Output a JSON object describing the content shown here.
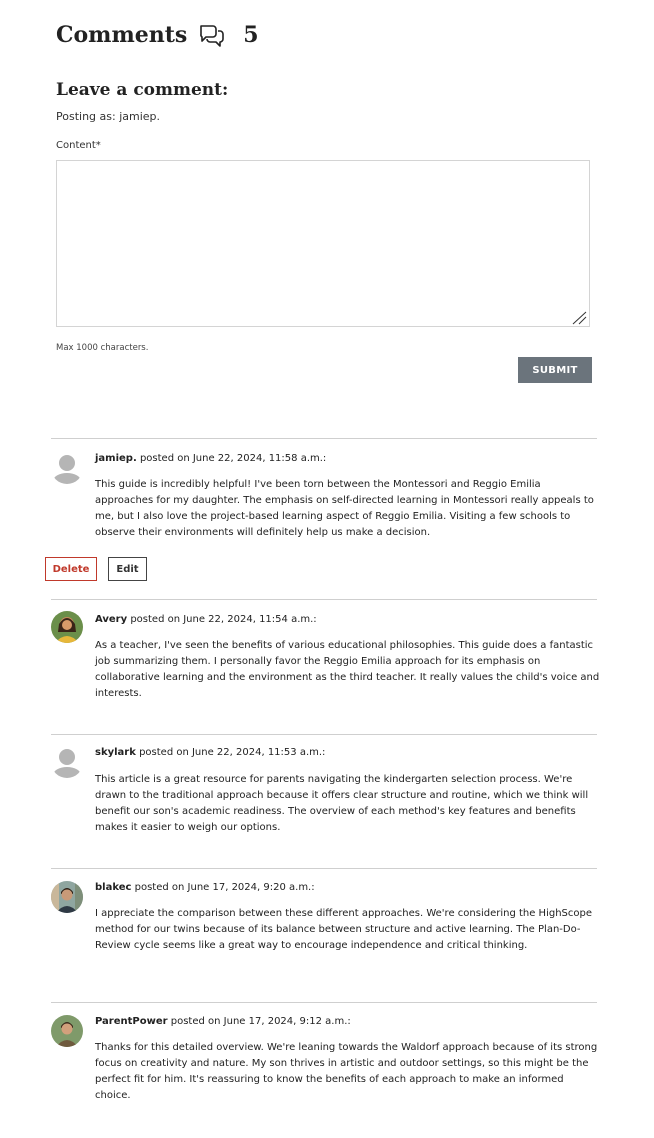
{
  "header": {
    "title": "Comments",
    "icon": "comments-icon",
    "count": "5"
  },
  "form": {
    "title": "Leave a comment:",
    "posting_as": "Posting as: jamiep.",
    "content_label": "Content*",
    "content_value": "",
    "max_chars": "Max 1000 characters.",
    "submit_label": "SUBMIT"
  },
  "comments": [
    {
      "author": "jamiep.",
      "posted": " posted on June 22, 2024, 11:58 a.m.:",
      "text": "This guide is incredibly helpful! I've been torn between the Montessori and Reggio Emilia approaches for my daughter. The emphasis on self-directed learning in Montessori really appeals to me, but I also love the project-based learning aspect of Reggio Emilia. Visiting a few schools to observe their environments will definitely help us make a decision.",
      "avatar": "default-avatar-icon"
    },
    {
      "author": "Avery",
      "posted": " posted on June 22, 2024, 11:54 a.m.:",
      "text": "As a teacher, I've seen the benefits of various educational philosophies. This guide does a fantastic job summarizing them. I personally favor the Reggio Emilia approach for its emphasis on collaborative learning and the environment as the third teacher. It really values the child's voice and interests.",
      "avatar": "user-photo-avatar"
    },
    {
      "author": "skylark",
      "posted": " posted on June 22, 2024, 11:53 a.m.:",
      "text": "This article is a great resource for parents navigating the kindergarten selection process. We're drawn to the traditional approach because it offers clear structure and routine, which we think will benefit our son's academic readiness. The overview of each method's key features and benefits makes it easier to weigh our options.",
      "avatar": "default-avatar-icon"
    },
    {
      "author": "blakec",
      "posted": " posted on June 17, 2024, 9:20 a.m.:",
      "text": "I appreciate the comparison between these different approaches. We're considering the HighScope method for our twins because of its balance between structure and active learning. The Plan-Do-Review cycle seems like a great way to encourage independence and critical thinking.",
      "avatar": "user-photo-avatar"
    },
    {
      "author": "ParentPower",
      "posted": " posted on June 17, 2024, 9:12 a.m.:",
      "text": "Thanks for this detailed overview. We're leaning towards the Waldorf approach because of its strong focus on creativity and nature. My son thrives in artistic and outdoor settings, so this might be the perfect fit for him. It's reassuring to know the benefits of each approach to make an informed choice.",
      "avatar": "user-photo-avatar"
    }
  ],
  "actions": {
    "delete_label": "Delete",
    "edit_label": "Edit"
  },
  "colors": {
    "submit_bg": "#6b747c",
    "delete": "#c0392b",
    "divider": "#cfcfcf"
  }
}
